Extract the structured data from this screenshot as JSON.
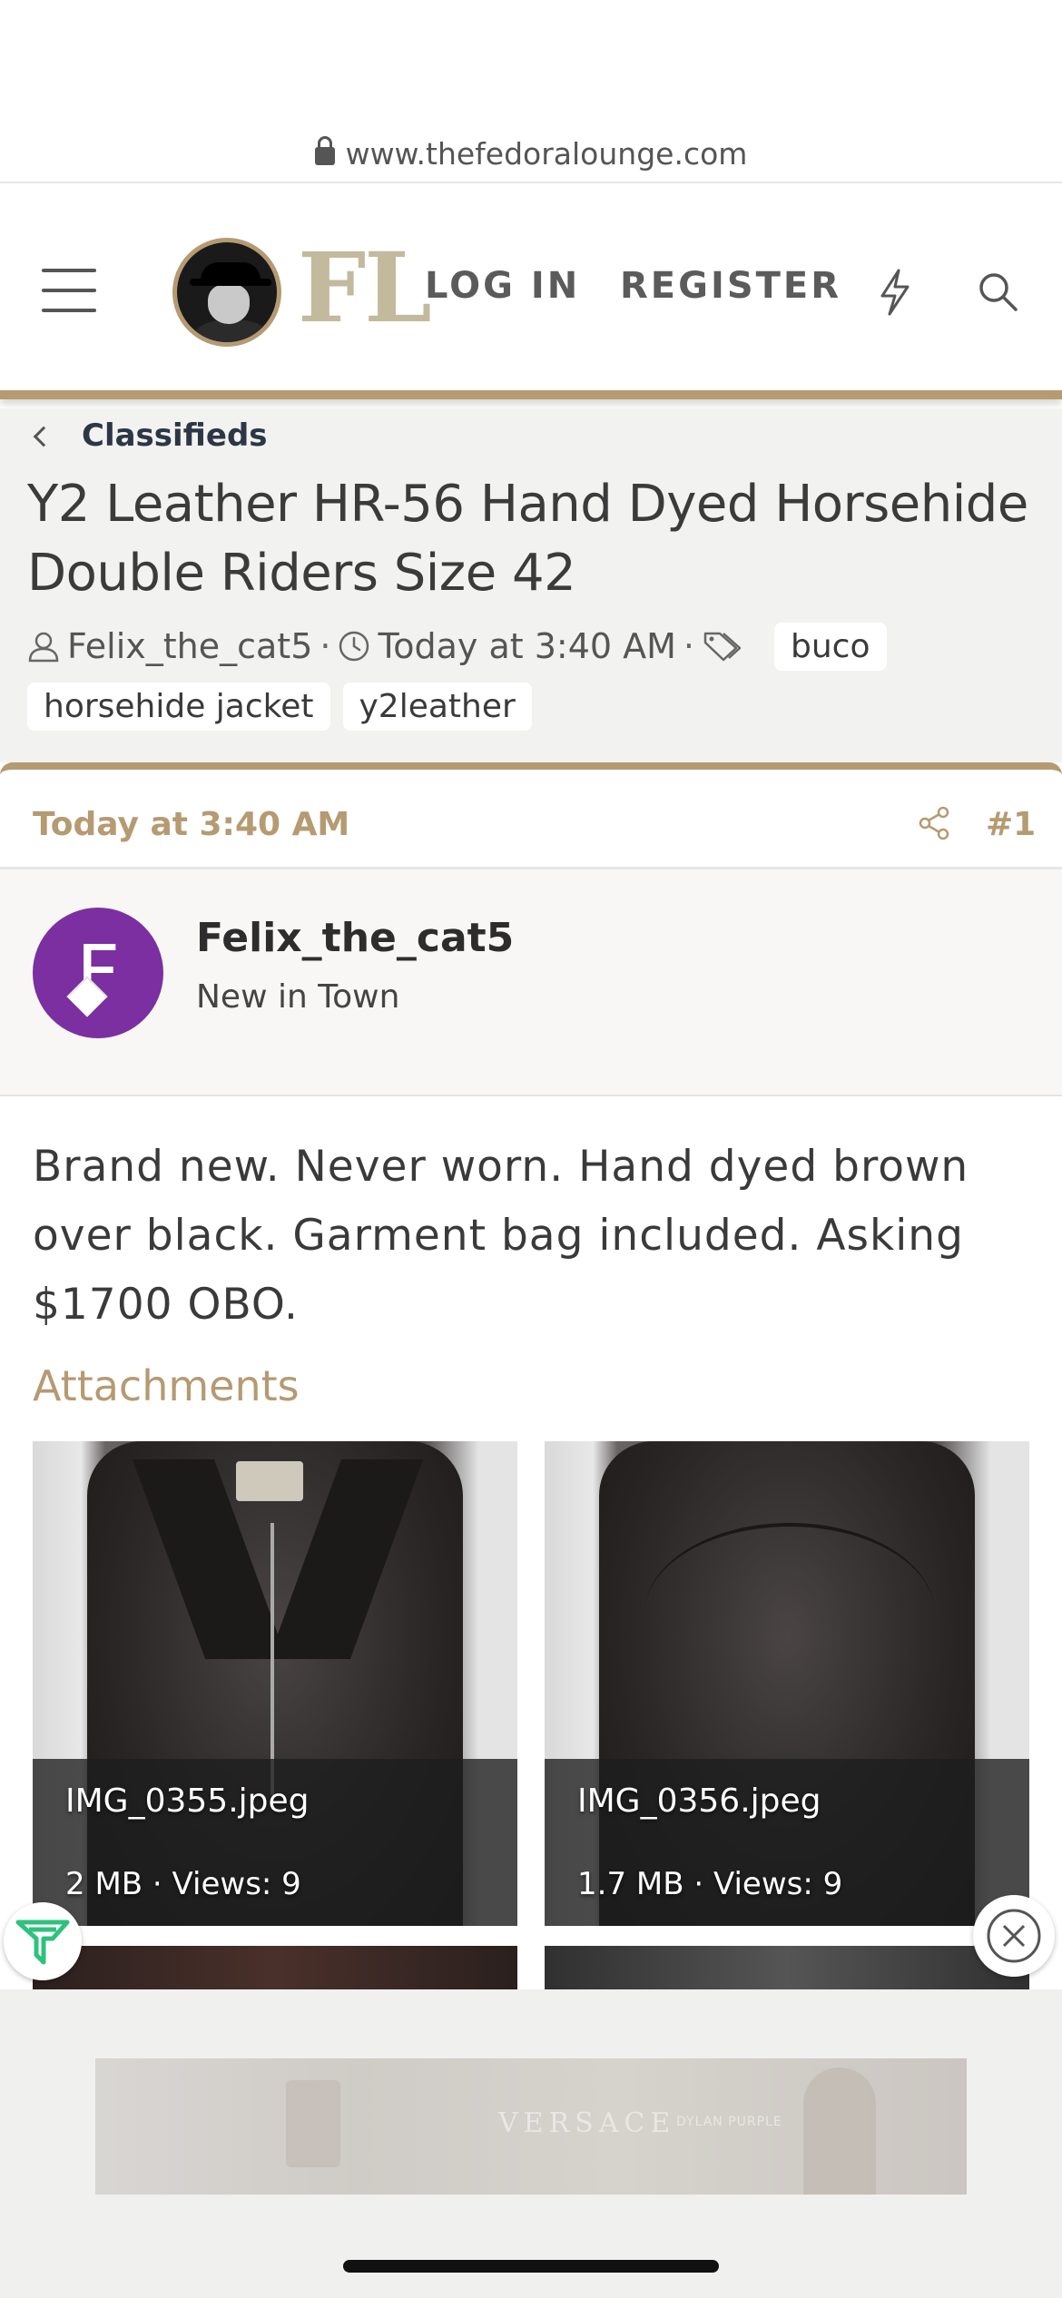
{
  "browser": {
    "url": "www.thefedoralounge.com"
  },
  "header": {
    "logo_text": "FL",
    "login_label": "LOG IN",
    "register_label": "REGISTER"
  },
  "breadcrumb": {
    "label": "Classifieds"
  },
  "thread": {
    "title": "Y2 Leather HR-56 Hand Dyed Horsehide Double Riders Size 42",
    "author": "Felix_the_cat5",
    "separator": "·",
    "time": "Today at 3:40 AM",
    "tags": [
      "buco",
      "horsehide jacket",
      "y2leather"
    ]
  },
  "post": {
    "date": "Today at 3:40 AM",
    "number": "#1",
    "avatar_letter": "F",
    "avatar_color": "#7b2fa0",
    "username": "Felix_the_cat5",
    "user_title": "New in Town",
    "body": "Brand new. Never worn. Hand dyed brown over black. Garment bag included. Asking $1700 OBO.",
    "attachments_title": "Attachments",
    "attachments": [
      {
        "filename": "IMG_0355.jpeg",
        "meta": "2 MB · Views: 9"
      },
      {
        "filename": "IMG_0356.jpeg",
        "meta": "1.7 MB · Views: 9"
      }
    ]
  },
  "ad": {
    "brand": "VERSACE",
    "sub": "DYLAN PURPLE"
  },
  "colors": {
    "accent": "#b59a72",
    "title_bg": "#f2f2f0"
  }
}
